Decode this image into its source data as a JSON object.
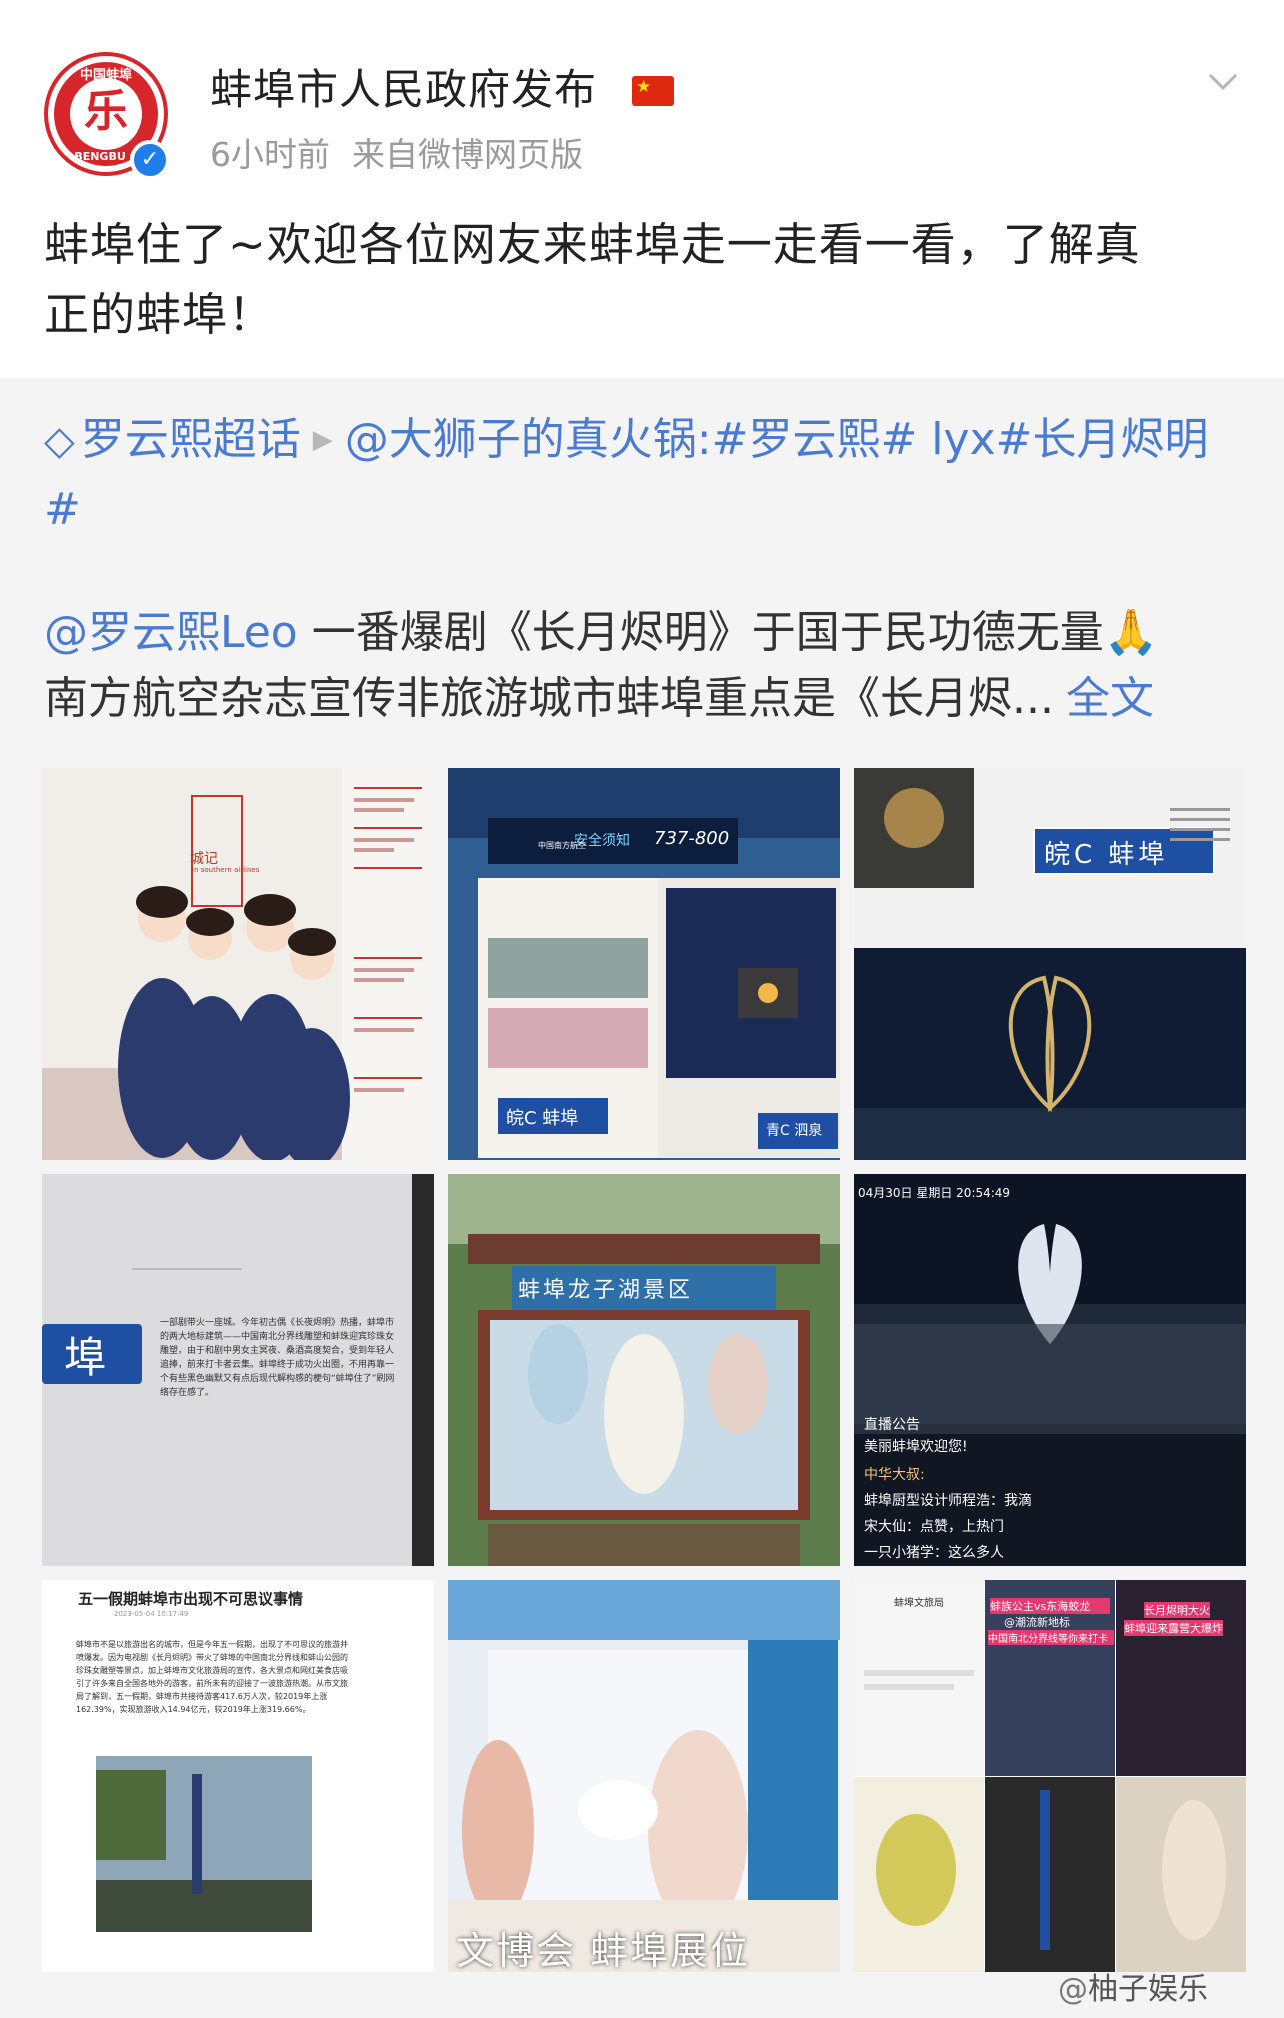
{
  "post": {
    "account_name": "蚌埠市人民政府发布",
    "flag_icon": "china-flag-icon",
    "time": "6小时前",
    "source": "来自微博网页版",
    "text_line1": "蚌埠住了~欢迎各位网友来蚌埠走一走看一看，了解真",
    "text_line2": "正的蚌埠！",
    "avatar_text_top": "中国蚌埠",
    "avatar_text_bottom": "BENGBU C",
    "avatar_glyph": "乐"
  },
  "repost": {
    "topic": "罗云熙超话",
    "author_mention": "@大狮子的真火锅",
    "tags_line1": ":#罗云熙# lyx#长月烬明",
    "tags_line2": "#",
    "mention": "@罗云熙Leo",
    "body_line1": " 一番爆剧《长月烬明》于国于民功德无量",
    "body_line2": "南方航空杂志宣传非旅游城市蚌埠重点是《长月烬...",
    "full_text_link": "全文",
    "pray_emoji": "🙏"
  },
  "images": [
    {
      "id": 1,
      "caption": "城记",
      "sub": "In southern airlines"
    },
    {
      "id": 2,
      "caption": "安全须知",
      "sub": "皖C 蚌埠",
      "plane": "737-800",
      "label2": "中国南方航空",
      "label3": "青C 泗泉"
    },
    {
      "id": 3,
      "caption": "皖C 蚌埠"
    },
    {
      "id": 4,
      "caption": "埠",
      "text": "一部剧带火一座城。今年初古偶《长夜烬明》热播，蚌埠市的两大地标建筑——中国南北分界线雕塑和蚌珠迎宾珍珠女雕塑，由于和剧中男女主冥夜、桑酒高度契合，受到年轻人追捧，前来打卡者云集。蚌埠终于成功火出圈，不用再靠一个有些黑色幽默又有点后现代解构感的梗句“蚌埠住了”刷网络存在感了。"
    },
    {
      "id": 5,
      "caption": "蚌埠龙子湖景区"
    },
    {
      "id": 6,
      "caption": "04月30日 星期日 20:54:49",
      "c1": "直播公告",
      "c2": "美丽蚌埠欢迎您!",
      "c3": "中华大叔:",
      "c4": "蚌埠厨型设计师程浩：我滴",
      "c5": "宋大仙：点赞，上热门",
      "c6": "一只小猪学：这么多人"
    },
    {
      "id": 7,
      "caption": "五一假期蚌埠市出现不可思议事情",
      "date": "2023-05-04 10:17:49",
      "text": "蚌埠市不是以旅游出名的城市，但是今年五一假期，出现了不可思议的旅游井喷爆发。因为电视剧《长月烬明》带火了蚌埠的中国南北分界线和蚌山公园的珍珠女雕塑等景点，加上蚌埠市文化旅游局的宣传，各大景点和网红美食店吸引了许多来自全国各地外的游客，前所未有的迎接了一波旅游热潮。从市文旅局了解到，五一假期，蚌埠市共接待游客417.6万人次，较2019年上涨162.39%，实现旅游收入14.94亿元，较2019年上涨319.66%。"
    },
    {
      "id": 8,
      "caption": "文博会 蚌埠展位"
    },
    {
      "id": 9,
      "caption": "蚌埠文旅局",
      "t2": "蚌族公主vs东海蛟龙",
      "t3": "@潮流新地标",
      "t4": "中国南北分界线等你来打卡",
      "t5": "长月烬明大火",
      "t6": "蚌埠迎来露营大爆炸"
    }
  ],
  "watermark": {
    "prefix": "@",
    "name": "柚子娱乐"
  },
  "colors": {
    "link": "#4b7bd1",
    "verify_badge": "#1e7fe8",
    "flag_red": "#de2910",
    "background": "#f4f4f4"
  }
}
